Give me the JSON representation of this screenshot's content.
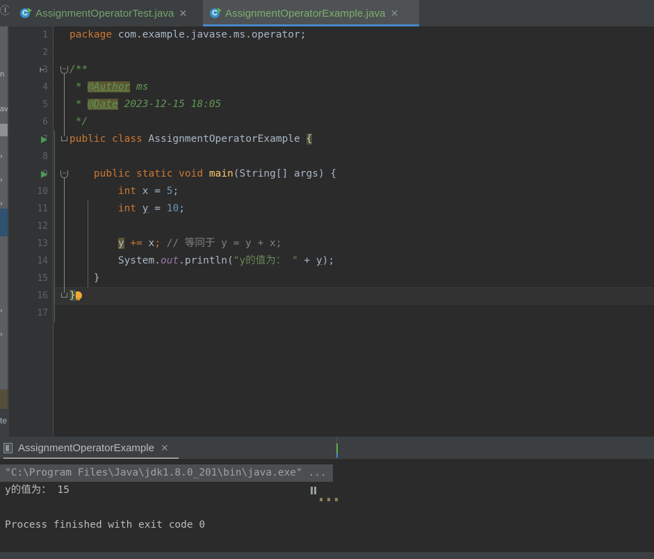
{
  "window": {
    "theme_bg": "#3C3F41",
    "editor_bg": "#2B2B2B",
    "gutter_bg": "#313335",
    "accent": "#4A88C7"
  },
  "left_strip": {
    "top_icon": "Ⓘ",
    "tree_rows": [
      {
        "label": "n",
        "state": "normal"
      },
      {
        "label": "av",
        "state": "normal"
      },
      {
        "label": "",
        "state": "hover"
      },
      {
        "label": "›",
        "state": "normal"
      },
      {
        "label": "›",
        "state": "normal"
      },
      {
        "label": "›",
        "state": "normal"
      },
      {
        "label": "✓",
        "state": "normal"
      },
      {
        "label": "",
        "state": "selected"
      }
    ],
    "lower_rows": [
      {
        "label": "›"
      },
      {
        "label": "›"
      }
    ],
    "bottom_label": "te"
  },
  "tabs": {
    "items": [
      {
        "label": "AssignmentOperatorTest.java",
        "icon": "java-class-icon",
        "icon_letter": "C",
        "active": false,
        "close_glyph": "✕"
      },
      {
        "label": "AssignmentOperatorExample.java",
        "icon": "java-class-icon",
        "icon_letter": "C",
        "active": true,
        "close_glyph": "✕"
      }
    ]
  },
  "editor": {
    "first_line": 1,
    "last_line": 17,
    "caret_line": 16,
    "line_numbers": [
      1,
      2,
      3,
      4,
      5,
      6,
      7,
      8,
      9,
      10,
      11,
      12,
      13,
      14,
      15,
      16,
      17
    ],
    "lines": [
      {
        "n": 1,
        "text": "package com.example.javase.ms.operator;"
      },
      {
        "n": 2,
        "text": ""
      },
      {
        "n": 3,
        "text": "/**"
      },
      {
        "n": 4,
        "text": " * @Author ms"
      },
      {
        "n": 5,
        "text": " * @Date 2023-12-15 18:05"
      },
      {
        "n": 6,
        "text": " */"
      },
      {
        "n": 7,
        "text": "public class AssignmentOperatorExample {"
      },
      {
        "n": 8,
        "text": ""
      },
      {
        "n": 9,
        "text": "    public static void main(String[] args) {"
      },
      {
        "n": 10,
        "text": "        int x = 5;"
      },
      {
        "n": 11,
        "text": "        int y = 10;"
      },
      {
        "n": 12,
        "text": ""
      },
      {
        "n": 13,
        "text": "        y += x; // 等同于 y = y + x;"
      },
      {
        "n": 14,
        "text": "        System.out.println(\"y的值为： \" + y);"
      },
      {
        "n": 15,
        "text": "    }"
      },
      {
        "n": 16,
        "text": "}"
      },
      {
        "n": 17,
        "text": ""
      }
    ],
    "tokens": {
      "package_kw": "package",
      "package_name": "com.example.javase.ms.operator;",
      "doc_open": "/**",
      "doc_star": "*",
      "tag_author": "@Author",
      "author_value": "ms",
      "tag_date": "@Date",
      "date_value": "2023-12-15 18:05",
      "doc_close": "*/",
      "public_kw": "public",
      "class_kw": "class",
      "class_name": "AssignmentOperatorExample",
      "open_brace": "{",
      "static_kw": "static",
      "void_kw": "void",
      "main_name": "main",
      "main_params": "(String[] args) {",
      "int_kw": "int",
      "var_x": "x",
      "assign": "=",
      "val_5": "5",
      "semi": ";",
      "var_y": "y",
      "val_10": "10",
      "plus_assign": "+=",
      "comment_13": "// 等同于 y = y + x;",
      "system": "System",
      "dot": ".",
      "out_field": "out",
      "println": "println",
      "paren_open": "(",
      "string_literal": "\"y的值为： \"",
      "concat": "+",
      "paren_close": ")",
      "close_brace_inner": "}",
      "close_brace_outer": "}"
    },
    "gutter": {
      "run_marker_lines": [
        7,
        9
      ],
      "bulb_line": 15,
      "fold_lines": [
        3,
        6,
        9,
        15
      ],
      "structure_glyph": "⊢"
    }
  },
  "console": {
    "tab_title": "AssignmentOperatorExample",
    "tab_icon": "console-icon",
    "close_glyph": "✕",
    "lines": [
      {
        "text": "\"C:\\Program Files\\Java\\jdk1.8.0_201\\bin\\java.exe\" ...",
        "highlight": true
      },
      {
        "text": "y的值为： 15",
        "highlight": false
      },
      {
        "text": "",
        "highlight": false
      },
      {
        "text": "Process finished with exit code 0",
        "highlight": false
      }
    ]
  }
}
